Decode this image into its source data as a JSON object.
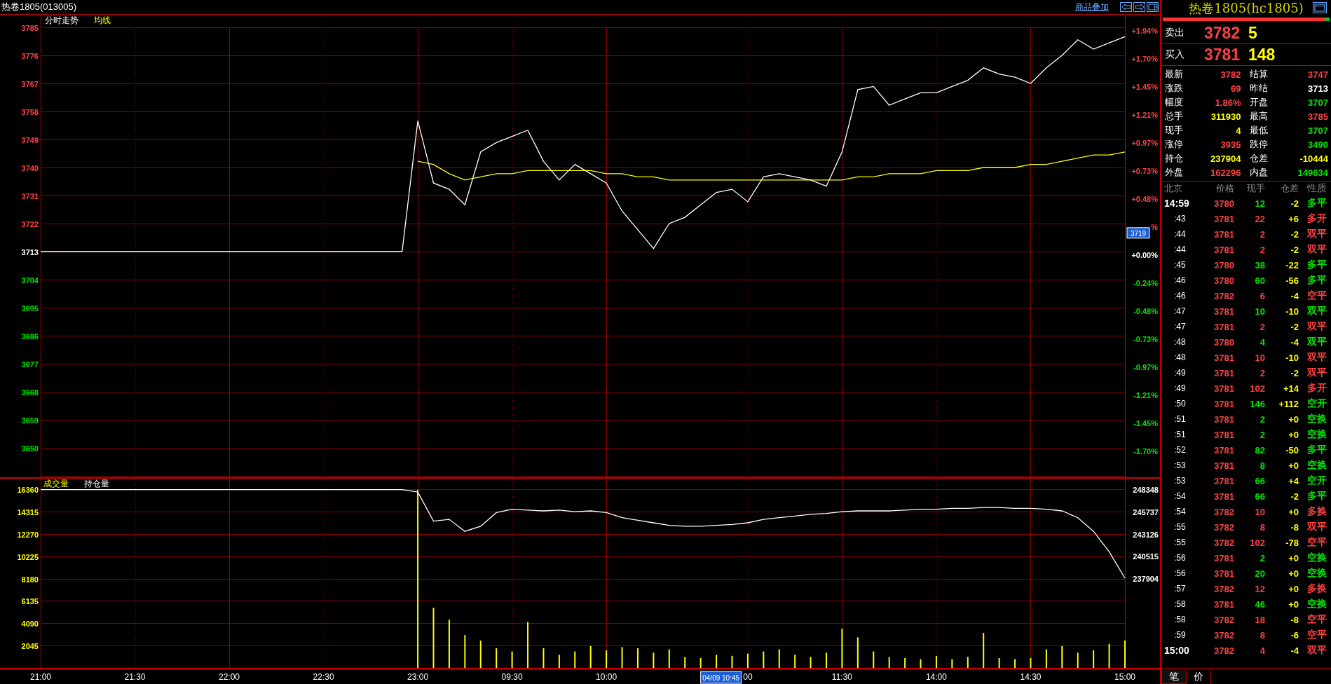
{
  "header": {
    "title": "热卷1805(013005)",
    "overlay_link": "商品叠加"
  },
  "price_chart": {
    "chart_data": {
      "type": "line",
      "grid": true,
      "ylim": [
        3641,
        3785
      ],
      "series": [
        {
          "name": "分时走势",
          "color": "#ffffff",
          "values": [
            3713,
            3713,
            3713,
            3713,
            3713,
            3713,
            3713,
            3713,
            3713,
            3713,
            3713,
            3713,
            3713,
            3713,
            3713,
            3713,
            3713,
            3713,
            3713,
            3713,
            3713,
            3713,
            3713,
            3713,
            3755,
            3735,
            3733,
            3728,
            3745,
            3748,
            3750,
            3752,
            3742,
            3736,
            3741,
            3738,
            3735,
            3726,
            3720,
            3714,
            3722,
            3724,
            3728,
            3732,
            3733,
            3729,
            3737,
            3738,
            3737,
            3736,
            3734,
            3745,
            3765,
            3766,
            3760,
            3762,
            3764,
            3764,
            3766,
            3768,
            3772,
            3770,
            3769,
            3767,
            3772,
            3776,
            3781,
            3778,
            3780,
            3782
          ]
        },
        {
          "name": "均线",
          "color": "#ffff00",
          "values": [
            null,
            null,
            null,
            null,
            null,
            null,
            null,
            null,
            null,
            null,
            null,
            null,
            null,
            null,
            null,
            null,
            null,
            null,
            null,
            null,
            null,
            null,
            null,
            null,
            3742,
            3741,
            3738,
            3736,
            3737,
            3738,
            3738,
            3739,
            3739,
            3739,
            3739,
            3739,
            3738,
            3738,
            3737,
            3737,
            3736,
            3736,
            3736,
            3736,
            3736,
            3736,
            3736,
            3736,
            3736,
            3736,
            3736,
            3736,
            3737,
            3737,
            3738,
            3738,
            3738,
            3739,
            3739,
            3739,
            3740,
            3740,
            3740,
            3741,
            3741,
            3742,
            3743,
            3744,
            3744,
            3745
          ]
        }
      ],
      "yticks": [
        3785,
        3776,
        3767,
        3758,
        3749,
        3740,
        3731,
        3722,
        3713,
        3704,
        3695,
        3686,
        3677,
        3668,
        3659,
        3650
      ]
    },
    "percent_labels": [
      "+1.94%",
      "+1.70%",
      "+1.45%",
      "+1.21%",
      "+0.97%",
      "+0.73%",
      "+0.48%",
      "%",
      "+0.00%",
      "-0.24%",
      "-0.48%",
      "-0.73%",
      "-0.97%",
      "-1.21%",
      "-1.45%",
      "-1.70%"
    ],
    "baseline": "3713",
    "price_tag": "3719"
  },
  "volume_chart": {
    "time_tag": "04/09 10:45",
    "volume": {
      "chart_data": {
        "type": "bar",
        "grid": true,
        "ylim": [
          0,
          16360
        ],
        "categories": [
          "21:00",
          null,
          null,
          null,
          null,
          null,
          "21:30",
          null,
          null,
          null,
          null,
          null,
          "22:00",
          null,
          null,
          null,
          null,
          null,
          "22:30",
          null,
          null,
          null,
          null,
          null,
          "23:00",
          null,
          null,
          null,
          null,
          null,
          "09:30",
          null,
          null,
          null,
          null,
          null,
          "10:00",
          null,
          null,
          null,
          null,
          null,
          null,
          null,
          null,
          "00",
          null,
          null,
          null,
          null,
          null,
          "11:30",
          null,
          null,
          null,
          null,
          null,
          "14:00",
          null,
          null,
          null,
          null,
          null,
          "14:30",
          null,
          null,
          null,
          null,
          null,
          "15:00"
        ],
        "series": [
          {
            "name": "成交量",
            "color": "#ffff00",
            "values": [
              null,
              null,
              null,
              null,
              null,
              null,
              null,
              null,
              null,
              null,
              null,
              null,
              null,
              null,
              null,
              null,
              null,
              null,
              null,
              null,
              null,
              null,
              null,
              null,
              16300,
              5500,
              4400,
              3000,
              2500,
              1800,
              1500,
              4200,
              1800,
              1200,
              1500,
              2000,
              1600,
              1900,
              1800,
              1400,
              1700,
              1000,
              900,
              1200,
              1100,
              1300,
              1500,
              1700,
              1200,
              1000,
              1400,
              3600,
              2800,
              1500,
              1000,
              900,
              800,
              1100,
              800,
              1000,
              3200,
              900,
              800,
              900,
              1700,
              2000,
              1400,
              1600,
              2200,
              2500
            ]
          }
        ],
        "yticks": [
          16360,
          14315,
          12270,
          10225,
          8180,
          6135,
          4090,
          2045
        ]
      }
    },
    "open_interest": {
      "chart_data": {
        "type": "line",
        "ylim": [
          237904,
          248348
        ],
        "series": [
          {
            "name": "持仓量",
            "color": "#ffffff",
            "values": [
              248300,
              248300,
              248300,
              248300,
              248300,
              248300,
              248300,
              248300,
              248300,
              248300,
              248300,
              248300,
              248300,
              248300,
              248300,
              248300,
              248300,
              248300,
              248300,
              248300,
              248300,
              248300,
              248300,
              248300,
              248000,
              244600,
              244800,
              243400,
              244000,
              245600,
              246000,
              245900,
              245800,
              245900,
              245700,
              245800,
              245600,
              245000,
              244700,
              244400,
              244100,
              244000,
              244000,
              244100,
              244200,
              244400,
              244800,
              245000,
              245200,
              245400,
              245500,
              245700,
              245800,
              245800,
              245800,
              245900,
              246000,
              246000,
              246100,
              246100,
              246200,
              246200,
              246100,
              246100,
              246000,
              245800,
              245000,
              243400,
              241000,
              237904
            ]
          }
        ],
        "yticks": [
          248348,
          245737,
          243126,
          240515,
          237904
        ]
      }
    }
  },
  "quote": {
    "title": "热卷1805(hc1805)",
    "ratio": {
      "level": 0.97
    },
    "ask": {
      "label": "卖出",
      "price": "3782",
      "volume": "5"
    },
    "bid": {
      "label": "买入",
      "price": "3781",
      "volume": "148"
    },
    "stats": [
      {
        "label": "最新",
        "value": "3782",
        "color": "#ff4040"
      },
      {
        "label": "结算",
        "value": "3747",
        "color": "#ff4040"
      },
      {
        "label": "涨跌",
        "value": "69",
        "color": "#ff4040"
      },
      {
        "label": "昨结",
        "value": "3713",
        "color": "#ffffff"
      },
      {
        "label": "幅度",
        "value": "1.86%",
        "color": "#ff4040"
      },
      {
        "label": "开盘",
        "value": "3707",
        "color": "#00e600"
      },
      {
        "label": "总手",
        "value": "311930",
        "color": "#ffff00"
      },
      {
        "label": "最高",
        "value": "3785",
        "color": "#ff4040"
      },
      {
        "label": "现手",
        "value": "4",
        "color": "#ffff00"
      },
      {
        "label": "最低",
        "value": "3707",
        "color": "#00e600"
      },
      {
        "label": "涨停",
        "value": "3935",
        "color": "#ff4040"
      },
      {
        "label": "跌停",
        "value": "3490",
        "color": "#00e600"
      },
      {
        "label": "持仓",
        "value": "237904",
        "color": "#ffff00"
      },
      {
        "label": "仓差",
        "value": "-10444",
        "color": "#ffff00"
      },
      {
        "label": "外盘",
        "value": "162296",
        "color": "#ff4040"
      },
      {
        "label": "内盘",
        "value": "149634",
        "color": "#00e600"
      }
    ],
    "trades": {
      "columns": [
        "北京",
        "价格",
        "现手",
        "仓差",
        "性质"
      ],
      "rows": [
        {
          "kind": "full",
          "time": "14:59",
          "price": "3780",
          "volume": "12",
          "change": "-2",
          "nature": "多平",
          "color": "#00e600"
        },
        {
          "kind": "minute",
          "time": ":43",
          "price": "3781",
          "volume": "22",
          "change": "+6",
          "nature": "多开",
          "color": "#ff4040"
        },
        {
          "kind": "minute",
          "time": ":44",
          "price": "3781",
          "volume": "2",
          "change": "-2",
          "nature": "双平",
          "color": "#ff4040"
        },
        {
          "kind": "minute",
          "time": ":44",
          "price": "3781",
          "volume": "2",
          "change": "-2",
          "nature": "双平",
          "color": "#ff4040"
        },
        {
          "kind": "minute",
          "time": ":45",
          "price": "3780",
          "volume": "38",
          "change": "-22",
          "nature": "多平",
          "color": "#00e600"
        },
        {
          "kind": "minute",
          "time": ":46",
          "price": "3780",
          "volume": "60",
          "change": "-56",
          "nature": "多平",
          "color": "#00e600"
        },
        {
          "kind": "minute",
          "time": ":46",
          "price": "3782",
          "volume": "6",
          "change": "-4",
          "nature": "空平",
          "color": "#ff4040"
        },
        {
          "kind": "minute",
          "time": ":47",
          "price": "3781",
          "volume": "10",
          "change": "-10",
          "nature": "双平",
          "color": "#00e600"
        },
        {
          "kind": "minute",
          "time": ":47",
          "price": "3781",
          "volume": "2",
          "change": "-2",
          "nature": "双平",
          "color": "#ff4040"
        },
        {
          "kind": "minute",
          "time": ":48",
          "price": "3780",
          "volume": "4",
          "change": "-4",
          "nature": "双平",
          "color": "#00e600"
        },
        {
          "kind": "minute",
          "time": ":48",
          "price": "3781",
          "volume": "10",
          "change": "-10",
          "nature": "双平",
          "color": "#ff4040"
        },
        {
          "kind": "minute",
          "time": ":49",
          "price": "3781",
          "volume": "2",
          "change": "-2",
          "nature": "双平",
          "color": "#ff4040"
        },
        {
          "kind": "minute",
          "time": ":49",
          "price": "3781",
          "volume": "102",
          "change": "+14",
          "nature": "多开",
          "color": "#ff4040"
        },
        {
          "kind": "minute",
          "time": ":50",
          "price": "3781",
          "volume": "146",
          "change": "+112",
          "nature": "空开",
          "color": "#00e600"
        },
        {
          "kind": "minute",
          "time": ":51",
          "price": "3781",
          "volume": "2",
          "change": "+0",
          "nature": "空换",
          "color": "#00e600"
        },
        {
          "kind": "minute",
          "time": ":51",
          "price": "3781",
          "volume": "2",
          "change": "+0",
          "nature": "空换",
          "color": "#00e600"
        },
        {
          "kind": "minute",
          "time": ":52",
          "price": "3781",
          "volume": "82",
          "change": "-50",
          "nature": "多平",
          "color": "#00e600"
        },
        {
          "kind": "minute",
          "time": ":53",
          "price": "3781",
          "volume": "8",
          "change": "+0",
          "nature": "空换",
          "color": "#00e600"
        },
        {
          "kind": "minute",
          "time": ":53",
          "price": "3781",
          "volume": "66",
          "change": "+4",
          "nature": "空开",
          "color": "#00e600"
        },
        {
          "kind": "minute",
          "time": ":54",
          "price": "3781",
          "volume": "66",
          "change": "-2",
          "nature": "多平",
          "color": "#00e600"
        },
        {
          "kind": "minute",
          "time": ":54",
          "price": "3782",
          "volume": "10",
          "change": "+0",
          "nature": "多换",
          "color": "#ff4040"
        },
        {
          "kind": "minute",
          "time": ":55",
          "price": "3782",
          "volume": "8",
          "change": "-8",
          "nature": "双平",
          "color": "#ff4040"
        },
        {
          "kind": "minute",
          "time": ":55",
          "price": "3782",
          "volume": "102",
          "change": "-78",
          "nature": "空平",
          "color": "#ff4040"
        },
        {
          "kind": "minute",
          "time": ":56",
          "price": "3781",
          "volume": "2",
          "change": "+0",
          "nature": "空换",
          "color": "#00e600"
        },
        {
          "kind": "minute",
          "time": ":56",
          "price": "3781",
          "volume": "20",
          "change": "+0",
          "nature": "空换",
          "color": "#00e600"
        },
        {
          "kind": "minute",
          "time": ":57",
          "price": "3782",
          "volume": "12",
          "change": "+0",
          "nature": "多换",
          "color": "#ff4040"
        },
        {
          "kind": "minute",
          "time": ":58",
          "price": "3781",
          "volume": "46",
          "change": "+0",
          "nature": "空换",
          "color": "#00e600"
        },
        {
          "kind": "minute",
          "time": ":58",
          "price": "3782",
          "volume": "18",
          "change": "-8",
          "nature": "空平",
          "color": "#ff4040"
        },
        {
          "kind": "minute",
          "time": ":59",
          "price": "3782",
          "volume": "8",
          "change": "-6",
          "nature": "空平",
          "color": "#ff4040"
        },
        {
          "kind": "full",
          "time": "15:00",
          "price": "3782",
          "volume": "4",
          "change": "-4",
          "nature": "双平",
          "color": "#ff4040"
        }
      ]
    },
    "tabs": [
      {
        "label": "笔",
        "selected": true
      },
      {
        "label": "价",
        "selected": false
      }
    ]
  }
}
